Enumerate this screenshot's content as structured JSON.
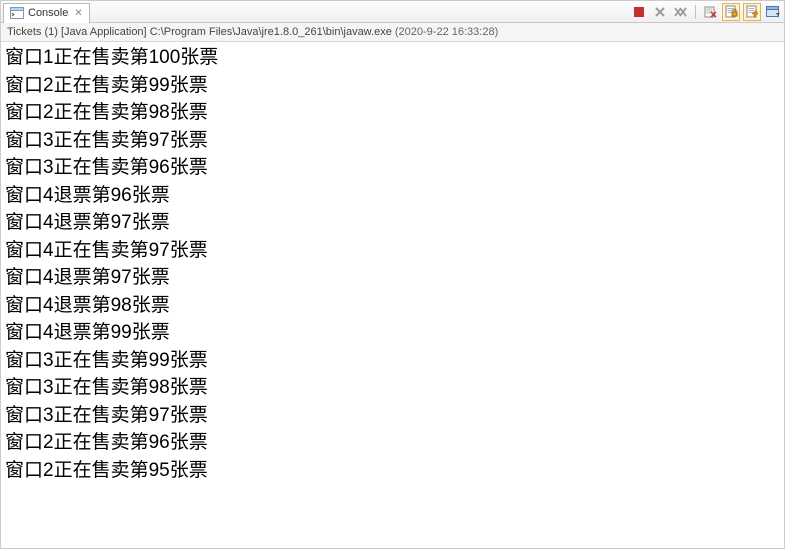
{
  "tab": {
    "title": "Console",
    "close_glyph": "✕"
  },
  "toolbar": {
    "terminate_icon": "terminate",
    "remove_launch_icon": "remove-launch",
    "remove_all_icon": "remove-all",
    "clear_icon": "clear",
    "scroll_lock_icon": "scroll-lock",
    "pin_icon": "pin",
    "display_icon": "display"
  },
  "run": {
    "launch_name": "Tickets (1)",
    "launch_type": "[Java Application]",
    "exe_path": "C:\\Program Files\\Java\\jre1.8.0_261\\bin\\javaw.exe",
    "timestamp": "(2020-9-22 16:33:28)"
  },
  "output_lines": [
    "窗口1正在售卖第100张票",
    "窗口2正在售卖第99张票",
    "窗口2正在售卖第98张票",
    "窗口3正在售卖第97张票",
    "窗口3正在售卖第96张票",
    "窗口4退票第96张票",
    "窗口4退票第97张票",
    "窗口4正在售卖第97张票",
    "窗口4退票第97张票",
    "窗口4退票第98张票",
    "窗口4退票第99张票",
    "窗口3正在售卖第99张票",
    "窗口3正在售卖第98张票",
    "窗口3正在售卖第97张票",
    "窗口2正在售卖第96张票",
    "窗口2正在售卖第95张票"
  ]
}
